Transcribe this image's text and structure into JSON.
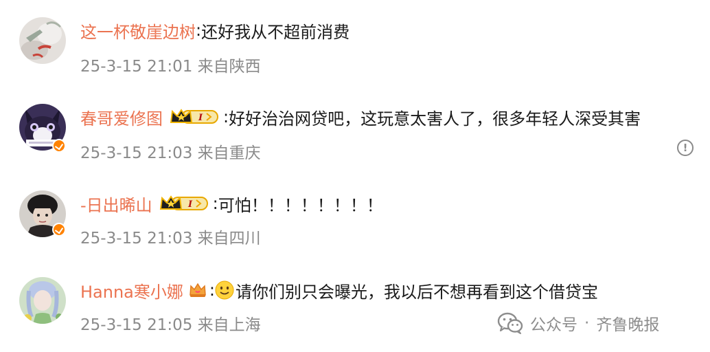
{
  "comments": [
    {
      "username": "这一杯敬崖边树",
      "separator": ":",
      "text": "还好我从不超前消费",
      "meta": "25-3-15 21:01 来自陕西"
    },
    {
      "username": "春哥爱修图",
      "separator": ":",
      "text": "好好治治网贷吧，这玩意太害人了，很多年轻人深受其害",
      "meta": "25-3-15 21:03 来自重庆",
      "badge_level": "I"
    },
    {
      "username": "-日出晞山",
      "separator": ":",
      "text": "可怕！！！！！！！！",
      "meta": "25-3-15 21:03 来自四川",
      "badge_level": "I"
    },
    {
      "username": "Hanna寒小娜",
      "separator": ":",
      "text": "请你们别只会曝光，我以后不想再看到这个借贷宝",
      "meta": "25-3-15 21:05 来自上海"
    }
  ],
  "report_icon": "!",
  "watermark": {
    "source": "公众号",
    "dot": "·",
    "name": "齐鲁晚报"
  },
  "colors": {
    "username": "#eb7350",
    "meta": "#8a8a8a",
    "verified": "#ff8200",
    "crown_gold": "#f5b800"
  },
  "icons": [
    "avatar",
    "verified-badge-icon",
    "crown-level-badge-icon",
    "vip-crown-icon",
    "smile-emoji-icon",
    "report-icon",
    "wechat-icon"
  ]
}
